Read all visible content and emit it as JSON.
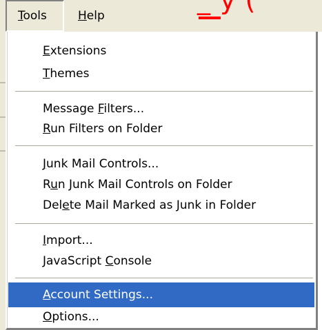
{
  "menubar": {
    "fragment_text": "_ у (",
    "tools_label": "Tools",
    "help_label": "Help"
  },
  "tools_menu": {
    "items": [
      {
        "label": "Extensions"
      },
      {
        "label": "Themes"
      },
      {
        "label": "Message Filters..."
      },
      {
        "label": "Run Filters on Folder"
      },
      {
        "label": "Junk Mail Controls..."
      },
      {
        "label": "Run Junk Mail Controls on Folder"
      },
      {
        "label": "Delete Mail Marked as Junk in Folder"
      },
      {
        "label": "Import..."
      },
      {
        "label": "JavaScript Console"
      },
      {
        "label": "Account Settings...",
        "selected": true
      },
      {
        "label": "Options..."
      }
    ]
  },
  "colors": {
    "menubar_bg": "#ece9d8",
    "selection_bg": "#316ac5",
    "selection_text": "#ffffff",
    "fragment_red": "#ff0000"
  }
}
